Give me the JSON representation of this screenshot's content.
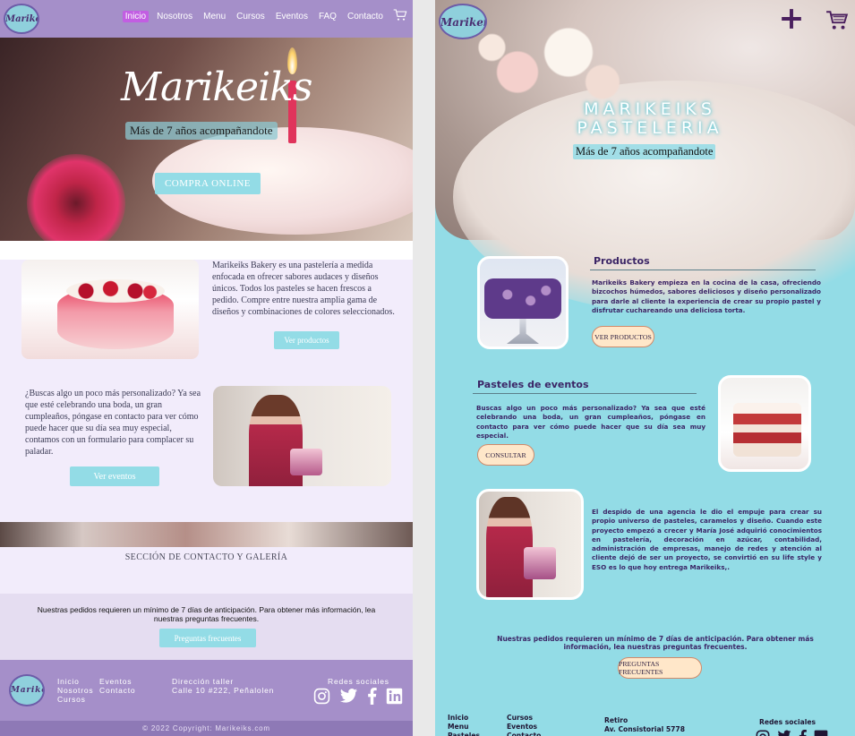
{
  "left": {
    "logo_text": "Marikeiks",
    "nav": [
      {
        "label": "Inicio",
        "active": true
      },
      {
        "label": "Nosotros"
      },
      {
        "label": "Menu"
      },
      {
        "label": "Cursos"
      },
      {
        "label": "Eventos"
      },
      {
        "label": "FAQ"
      },
      {
        "label": "Contacto"
      }
    ],
    "hero": {
      "brand": "Marikeiks",
      "tagline": "Más de 7 años acompañandote",
      "cta": "COMPRA ONLINE"
    },
    "about_text": "Marikeiks Bakery es una pastelería a medida enfocada en ofrecer sabores audaces y diseños únicos. Todos los pasteles se hacen frescos a pedido. Compre entre nuestra amplia gama de diseños y combinaciones de colores seleccionados.",
    "products_button": "Ver productos",
    "events_text": "¿Buscas algo un poco más personalizado? Ya sea que esté celebrando una boda, un gran cumpleaños, póngase en contacto para ver cómo puede hacer que su día sea muy especial, contamos con un formulario para complacer su paladar.",
    "events_button": "Ver eventos",
    "contact_section": "SECCIÓN DE CONTACTO Y GALERÍA",
    "notice": "Nuestras pedidos requieren un mínimo de 7 días de anticipación. Para obtener más información, lea nuestras preguntas frecuentes.",
    "faq_button": "Preguntas frecuentes",
    "footer": {
      "col1": [
        "Inicio",
        "Nosotros",
        "Cursos"
      ],
      "col2": [
        "Eventos",
        "Contacto"
      ],
      "address_title": "Dirección taller",
      "address": "Calle 10 #222, Peñalolen",
      "social_title": "Redes sociales",
      "copyright": "© 2022 Copyright: Marikeiks.com"
    }
  },
  "right": {
    "logo_text": "Marikeiks",
    "hero": {
      "title_line1": "MARIKEIKS",
      "title_line2": "PASTELERIA",
      "tagline": "Más de 7 años acompañandote"
    },
    "productos_title": "Productos",
    "productos_text": "Marikeiks Bakery empieza en la cocina de la casa, ofreciendo bizcochos húmedos, sabores deliciosos y diseño personalizado para darle al cliente la experiencia de crear su propio pastel y disfrutar cuchareando una deliciosa torta.",
    "productos_button": "VER PRODUCTOS",
    "eventos_title": "Pasteles de eventos",
    "eventos_text": "Buscas algo un poco más personalizado? Ya sea que esté celebrando una boda, un gran cumpleaños, póngase en contacto para ver cómo puede hacer que su día sea muy especial.",
    "eventos_button": "CONSULTAR",
    "story_text": "El despido de una agencia le dio el empuje para crear su propio universo de pasteles, caramelos y diseño. Cuando este proyecto empezó a crecer y María José adquirió conocimientos en pastelería, decoración en azúcar, contabilidad, administración de empresas, manejo de redes y atención al cliente dejó de ser un proyecto, se convirtió en su life style y ESO es lo que hoy entrega Marikeiks,.",
    "notice": "Nuestras pedidos requieren un mínimo de 7 días de anticipación. Para obtener más información, lea nuestras preguntas frecuentes.",
    "faq_button": "PREGUNTAS FRECUENTES",
    "footer": {
      "col1": [
        "Inicio",
        "Menu",
        "Pasteles"
      ],
      "col2": [
        "Cursos",
        "Eventos",
        "Contacto"
      ],
      "retiro_title": "Retiro",
      "retiro_address": "Av. Consistorial 5778",
      "social_title": "Redes sociales"
    }
  },
  "colors": {
    "left_nav": "#a58fc9",
    "left_accent": "#93dce6",
    "left_active": "#c25ee2",
    "right_bg": "#93dce6",
    "right_text": "#3b2566",
    "right_button": "#ffe7c9"
  },
  "icons": [
    "cart-icon",
    "plus-icon",
    "instagram-icon",
    "twitter-icon",
    "facebook-icon",
    "linkedin-icon"
  ]
}
